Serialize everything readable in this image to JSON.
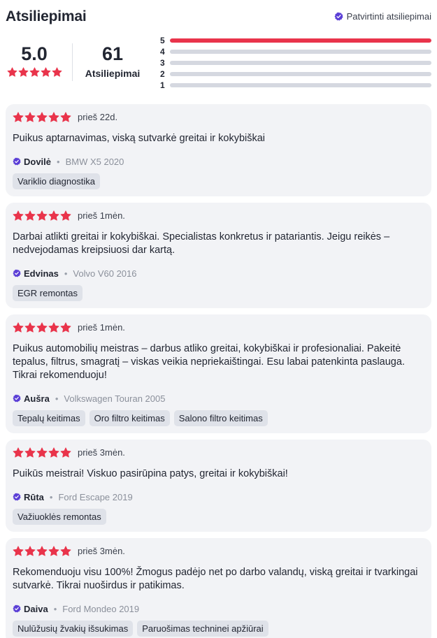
{
  "header": {
    "title": "Atsiliepimai",
    "verified_label": "Patvirtinti atsiliepimai"
  },
  "summary": {
    "average": "5.0",
    "average_stars": 5,
    "count": "61",
    "count_label": "Atsiliepimai",
    "distribution": [
      {
        "label": "5",
        "fraction": 1.0
      },
      {
        "label": "4",
        "fraction": 0.0
      },
      {
        "label": "3",
        "fraction": 0.0
      },
      {
        "label": "2",
        "fraction": 0.0
      },
      {
        "label": "1",
        "fraction": 0.0
      }
    ]
  },
  "colors": {
    "star": "#e9344b",
    "verified": "#5b3fd6",
    "card_bg": "#f2f3f6",
    "tag_bg": "#dfe2e9"
  },
  "reviews": [
    {
      "rating": 5,
      "time": "prieš 22d.",
      "text": "Puikus aptarnavimas, viską sutvarkė greitai ir kokybiškai",
      "author": "Dovilė",
      "car": "BMW X5 2020",
      "tags": [
        "Variklio diagnostika"
      ]
    },
    {
      "rating": 5,
      "time": "prieš 1mėn.",
      "text": "Darbai atlikti greitai ir kokybiškai. Specialistas konkretus ir patariantis. Jeigu reikės – nedvejodamas kreipsiuosi dar kartą.",
      "author": "Edvinas",
      "car": "Volvo V60 2016",
      "tags": [
        "EGR remontas"
      ]
    },
    {
      "rating": 5,
      "time": "prieš 1mėn.",
      "text": "Puikus automobilių meistras – darbus atliko greitai, kokybiškai ir profesionaliai. Pakeitė tepalus, filtrus, smagratį – viskas veikia nepriekaištingai. Esu labai patenkinta paslauga. Tikrai rekomenduoju!",
      "author": "Aušra",
      "car": "Volkswagen Touran 2005",
      "tags": [
        "Tepalų keitimas",
        "Oro filtro keitimas",
        "Salono filtro keitimas"
      ]
    },
    {
      "rating": 5,
      "time": "prieš 3mėn.",
      "text": "Puikūs meistrai! Viskuo pasirūpina patys, greitai ir kokybiškai!",
      "author": "Rūta",
      "car": "Ford Escape 2019",
      "tags": [
        "Važiuoklės remontas"
      ]
    },
    {
      "rating": 5,
      "time": "prieš 3mėn.",
      "text": "Rekomenduoju visu 100%! Žmogus padėjo net po darbo valandų, viską greitai ir tvarkingai sutvarkė. Tikrai nuoširdus ir patikimas.",
      "author": "Daiva",
      "car": "Ford Mondeo 2019",
      "tags": [
        "Nulūžusių žvakių išsukimas",
        "Paruošimas techninei apžiūrai"
      ]
    }
  ]
}
